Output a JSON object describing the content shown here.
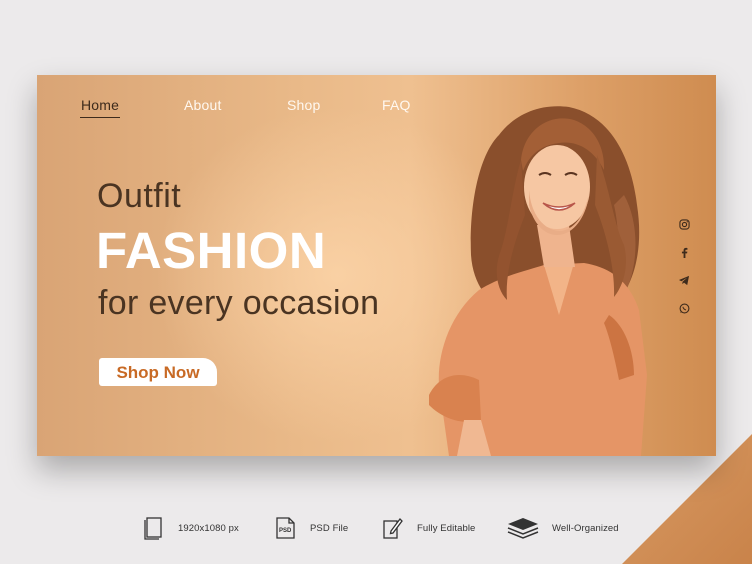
{
  "nav": {
    "items": [
      {
        "label": "Home",
        "active": true
      },
      {
        "label": "About",
        "active": false
      },
      {
        "label": "Shop",
        "active": false
      },
      {
        "label": "FAQ",
        "active": false
      }
    ]
  },
  "hero": {
    "line1": "Outfit",
    "line2": "FASHION",
    "line3": "for every occasion",
    "cta_label": "Shop Now"
  },
  "socials": [
    "instagram-icon",
    "facebook-icon",
    "telegram-icon",
    "whatsapp-icon"
  ],
  "features": [
    {
      "icon": "document-icon",
      "label": "1920x1080 px"
    },
    {
      "icon": "psd-file-icon",
      "label": "PSD File"
    },
    {
      "icon": "edit-pencil-icon",
      "label": "Fully Editable"
    },
    {
      "icon": "layers-icon",
      "label": "Well-Organized"
    }
  ],
  "colors": {
    "accent": "#c86a25",
    "heading_dark": "#4a3422",
    "banner_light": "#efc090",
    "banner_dark": "#cf8c50",
    "page_bg": "#eceaeb"
  }
}
